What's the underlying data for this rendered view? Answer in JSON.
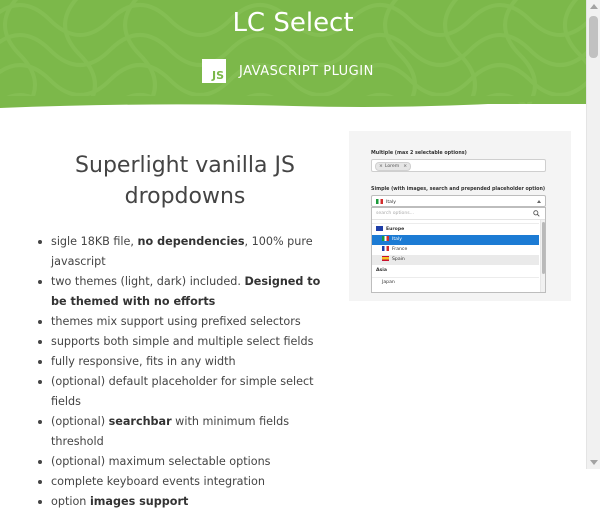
{
  "header": {
    "title": "LC Select",
    "logo_text": "JS",
    "subtitle": "JAVASCRIPT PLUGIN",
    "background_color": "#7cb84a"
  },
  "tagline": {
    "line1": "Superlight vanilla JS",
    "line2": "dropdowns"
  },
  "features": [
    {
      "pre": "sigle 18KB file, ",
      "bold": "no dependencies",
      "post": ", 100% pure javascript"
    },
    {
      "pre": "two themes (light, dark) included. ",
      "bold": "Designed to be themed with no efforts",
      "post": ""
    },
    {
      "pre": "themes mix support using prefixed selectors",
      "bold": "",
      "post": ""
    },
    {
      "pre": "supports both simple and multiple select fields",
      "bold": "",
      "post": ""
    },
    {
      "pre": "fully responsive, fits in any width",
      "bold": "",
      "post": ""
    },
    {
      "pre": "(optional) default placeholder for simple select fields",
      "bold": "",
      "post": ""
    },
    {
      "pre": "(optional) ",
      "bold": "searchbar",
      "post": " with minimum fields threshold"
    },
    {
      "pre": "(optional) maximum selectable options",
      "bold": "",
      "post": ""
    },
    {
      "pre": "complete keyboard events integration",
      "bold": "",
      "post": ""
    },
    {
      "pre": "option ",
      "bold": "images support",
      "post": ""
    }
  ],
  "demo": {
    "multi_label": "Multiple (max 2 selectable options)",
    "multi_tag": "Lorem",
    "simple_label": "Simple (with images, search and prepended placeholder option)",
    "selected_value": "Italy",
    "search_placeholder": "search options...",
    "options": {
      "group_europe": "Europe",
      "italy": "Italy",
      "france": "France",
      "spain": "Spain",
      "group_asia": "Asia",
      "japan": "Japan"
    },
    "selected_color": "#1c7bd4"
  },
  "icons": {
    "search": "search-icon",
    "remove": "close-icon",
    "caret": "chevron-up-icon"
  }
}
